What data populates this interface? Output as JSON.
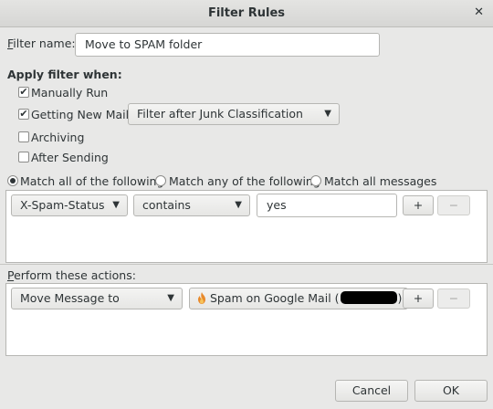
{
  "window": {
    "title": "Filter Rules"
  },
  "filter_name": {
    "label": "Filter name:",
    "value": "Move to SPAM folder"
  },
  "apply_when": {
    "heading": "Apply filter when:",
    "manually_run": {
      "label": "Manually Run",
      "checked": true
    },
    "getting_new_mail": {
      "label": "Getting New Mail:",
      "checked": true,
      "dropdown": "Filter after Junk Classification"
    },
    "archiving": {
      "label": "Archiving",
      "checked": false
    },
    "after_sending": {
      "label": "After Sending",
      "checked": false
    }
  },
  "match": {
    "all_label": "Match all of the following",
    "any_label": "Match any of the following",
    "all_messages_label": "Match all messages",
    "selected": "all"
  },
  "rule": {
    "field": "X-Spam-Status",
    "operator": "contains",
    "value": "yes",
    "add_label": "+",
    "remove_label": "−"
  },
  "actions": {
    "heading": "Perform these actions:",
    "action": "Move Message to",
    "target_prefix": "Spam on Google Mail (",
    "target_suffix": ")",
    "add_label": "+",
    "remove_label": "−"
  },
  "footer": {
    "cancel_label": "Cancel",
    "ok_label": "OK"
  }
}
